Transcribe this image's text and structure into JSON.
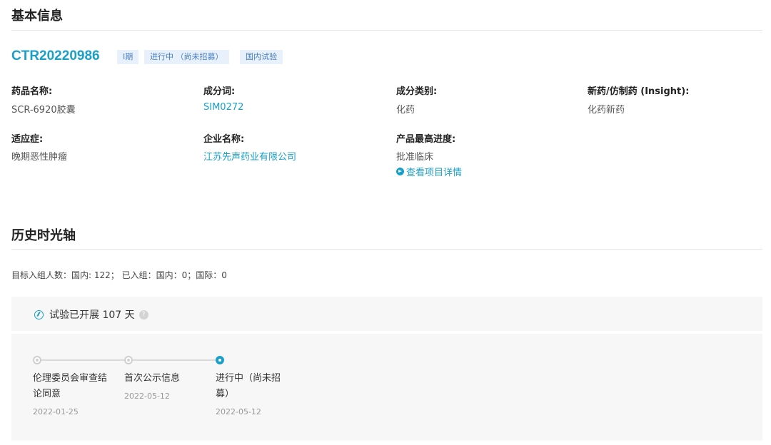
{
  "basic_info": {
    "title": "基本信息",
    "trial_id": "CTR20220986",
    "tags": [
      "I期",
      "进行中 （尚未招募）",
      "国内试验"
    ],
    "fields": {
      "drug_name": {
        "label": "药品名称:",
        "value": "SCR-6920胶囊"
      },
      "ingredient": {
        "label": "成分词:",
        "value": "SIM0272"
      },
      "ingredient_type": {
        "label": "成分类别:",
        "value": "化药"
      },
      "new_generic": {
        "label": "新药/仿制药 (Insight):",
        "value": "化药新药"
      },
      "indication": {
        "label": "适应症:",
        "value": "晚期恶性肿瘤"
      },
      "company": {
        "label": "企业名称:",
        "value": "江苏先声药业有限公司"
      },
      "max_progress": {
        "label": "产品最高进度:",
        "value": "批准临床"
      }
    },
    "project_detail_link": "查看项目详情",
    "link_color": "#1aa0c8"
  },
  "history": {
    "title": "历史时光轴",
    "enrollment": "目标入组人数：国内: 122； 已入组：国内：0；国际：0",
    "days_running": "试验已开展 107 天",
    "timeline": [
      {
        "label_lines": [
          "伦理委员会审查结",
          "论同意"
        ],
        "date": "2022-01-25",
        "status": "done"
      },
      {
        "label_lines": [
          "首次公示信息"
        ],
        "date": "2022-05-12",
        "status": "done"
      },
      {
        "label_lines": [
          "进行中（尚未招",
          "募）"
        ],
        "date": "2022-05-12",
        "status": "current"
      }
    ]
  }
}
